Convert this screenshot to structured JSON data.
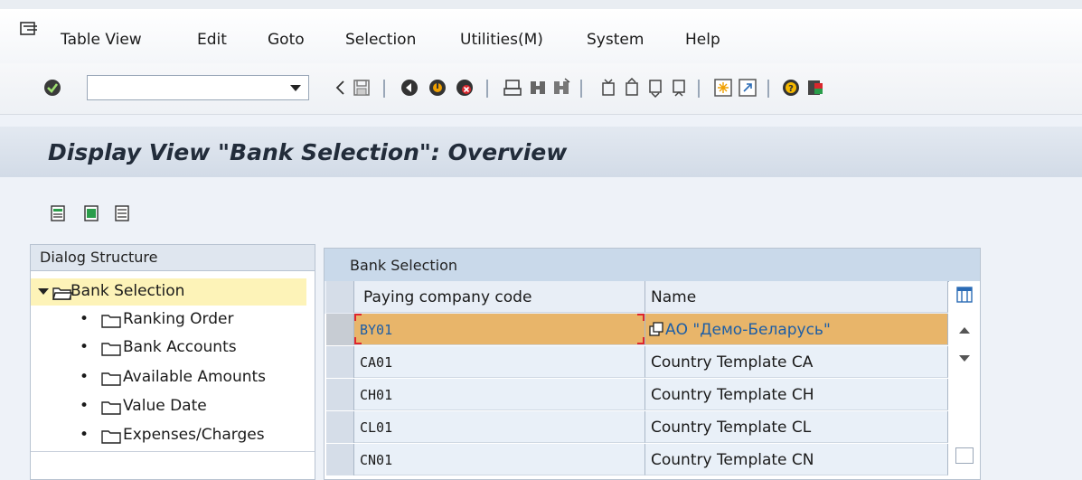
{
  "menu": {
    "items": [
      {
        "label": "Table View"
      },
      {
        "label": "Edit"
      },
      {
        "label": "Goto"
      },
      {
        "label": "Selection"
      },
      {
        "label": "Utilities(M)"
      },
      {
        "label": "System"
      },
      {
        "label": "Help"
      }
    ]
  },
  "toolbar": {
    "command_field_value": ""
  },
  "title": {
    "text": "Display View \"Bank Selection\": Overview"
  },
  "dialog_structure": {
    "header": "Dialog Structure",
    "root": {
      "label": "Bank Selection",
      "selected": true
    },
    "children": [
      {
        "label": "Ranking Order"
      },
      {
        "label": "Bank Accounts"
      },
      {
        "label": "Available Amounts"
      },
      {
        "label": "Value Date"
      },
      {
        "label": "Expenses/Charges"
      }
    ],
    "bullet": "•"
  },
  "table": {
    "title": "Bank Selection",
    "columns": [
      "Paying company code",
      "Name"
    ],
    "rows": [
      {
        "code": "BY01",
        "name": "АО \"Демо-Беларусь\"",
        "active": true
      },
      {
        "code": "CA01",
        "name": "Country Template CA"
      },
      {
        "code": "CH01",
        "name": "Country Template CH"
      },
      {
        "code": "CL01",
        "name": "Country Template CL"
      },
      {
        "code": "CN01",
        "name": "Country Template CN"
      }
    ]
  },
  "colors": {
    "active_row": "#e8b56a",
    "selected_tree": "#fdf3b8",
    "header_blue": "#c9d9ea",
    "active_text": "#1d5ea6"
  }
}
